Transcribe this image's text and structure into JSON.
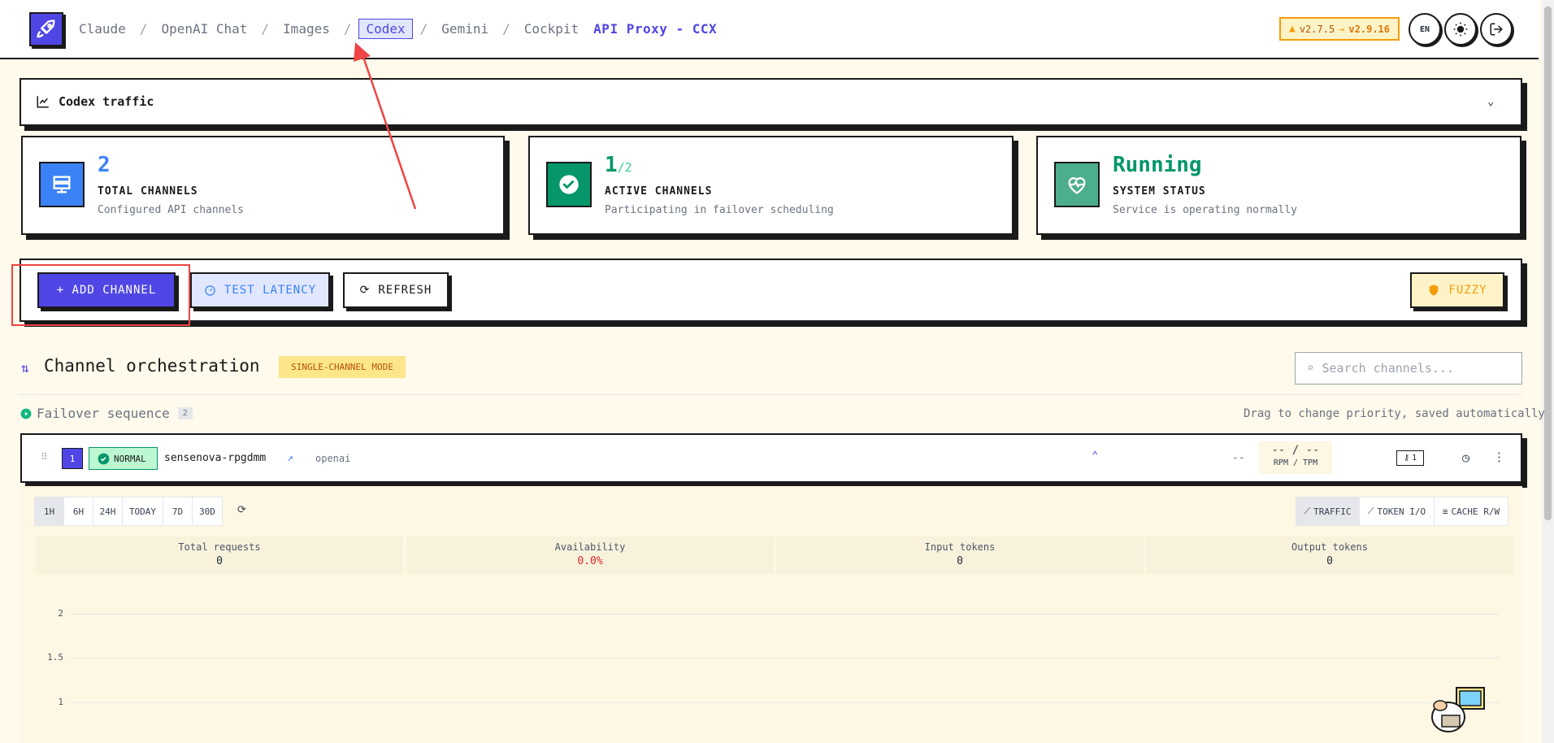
{
  "header": {
    "nav": [
      {
        "label": "Claude"
      },
      {
        "label": "OpenAI Chat"
      },
      {
        "label": "Images"
      },
      {
        "label": "Codex",
        "active": true
      },
      {
        "label": "Gemini"
      },
      {
        "label": "Cockpit"
      }
    ],
    "proxy_title": "API Proxy - CCX",
    "version_current": "v2.7.5",
    "version_arrow": "→",
    "version_new": "v2.9.16",
    "lang_label": "EN"
  },
  "traffic": {
    "title": "Codex traffic"
  },
  "stats": {
    "total": {
      "value": "2",
      "label": "TOTAL CHANNELS",
      "desc": "Configured API channels"
    },
    "active": {
      "value": "1",
      "total": "/2",
      "label": "ACTIVE CHANNELS",
      "desc": "Participating in failover scheduling"
    },
    "status": {
      "value": "Running",
      "label": "SYSTEM STATUS",
      "desc": "Service is operating normally"
    }
  },
  "actions": {
    "add_channel": "+ ADD CHANNEL",
    "test_latency": "TEST LATENCY",
    "refresh": "REFRESH",
    "fuzzy": "FUZZY"
  },
  "orchestration": {
    "title": "Channel orchestration",
    "mode": "SINGLE-CHANNEL MODE",
    "search_placeholder": "Search channels...",
    "failover_label": "Failover sequence",
    "failover_count": "2",
    "drag_hint": "Drag to change priority, saved automatically"
  },
  "channel": {
    "priority": "1",
    "status": "NORMAL",
    "name": "sensenova-rpgdmm",
    "type": "openai",
    "latency": "--",
    "rate": "-- / --",
    "rate_label": "RPM / TPM",
    "keys": "1"
  },
  "panel": {
    "ranges": [
      "1H",
      "6H",
      "24H",
      "TODAY",
      "7D",
      "30D"
    ],
    "active_range": "1H",
    "views": [
      "TRAFFIC",
      "TOKEN I/O",
      "CACHE R/W"
    ],
    "active_view": "TRAFFIC",
    "metrics": [
      {
        "label": "Total requests",
        "value": "0"
      },
      {
        "label": "Availability",
        "value": "0.0%"
      },
      {
        "label": "Input tokens",
        "value": "0"
      },
      {
        "label": "Output tokens",
        "value": "0"
      }
    ],
    "y_ticks": [
      "2",
      "1.5",
      "1"
    ]
  },
  "colors": {
    "accent": "#4f46e5",
    "success": "#059669",
    "warning": "#f59e0b",
    "danger": "#dc2626",
    "annotation_red": "#ef4444"
  }
}
